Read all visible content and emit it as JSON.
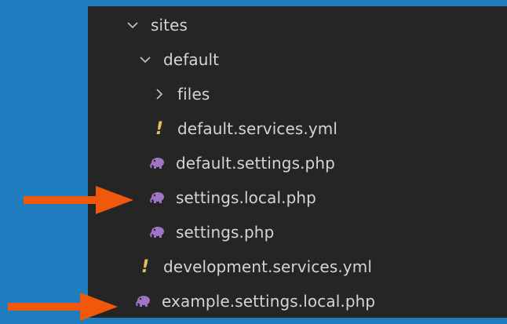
{
  "explorer": {
    "items": [
      {
        "label": "sites",
        "icon": "chevron-down-icon"
      },
      {
        "label": "default",
        "icon": "chevron-down-icon"
      },
      {
        "label": "files",
        "icon": "chevron-right-icon"
      },
      {
        "label": "default.services.yml",
        "icon": "yaml-exclamation-icon"
      },
      {
        "label": "default.settings.php",
        "icon": "php-elephant-icon"
      },
      {
        "label": "settings.local.php",
        "icon": "php-elephant-icon"
      },
      {
        "label": "settings.php",
        "icon": "php-elephant-icon"
      },
      {
        "label": "development.services.yml",
        "icon": "yaml-exclamation-icon"
      },
      {
        "label": "example.settings.local.php",
        "icon": "php-elephant-icon"
      }
    ],
    "yaml_glyph": "!"
  },
  "colors": {
    "background": "#1f7dbf",
    "panel": "#252526",
    "text": "#d4d4d4",
    "yaml_icon": "#e5c15a",
    "php_icon": "#a074c4",
    "annotation_arrow": "#f2580c"
  },
  "annotations": [
    {
      "icon": "arrow-right-icon",
      "points_to": "settings.local.php"
    },
    {
      "icon": "arrow-right-icon",
      "points_to": "example.settings.local.php"
    }
  ]
}
